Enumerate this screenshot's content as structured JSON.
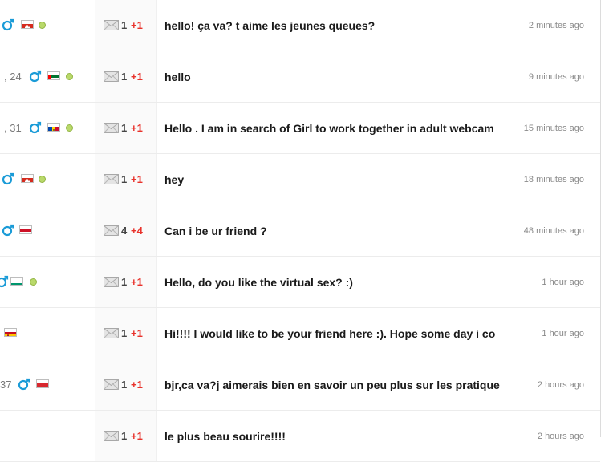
{
  "messages": [
    {
      "age": "",
      "flag": "switzerland-flag",
      "online": true,
      "male": true,
      "count": "1",
      "plus": "+1",
      "text": "hello! ça va? t aime les jeunes queues?",
      "time": "2 minutes ago"
    },
    {
      "age": ", 24",
      "flag": "uae-flag",
      "online": true,
      "male": true,
      "count": "1",
      "plus": "+1",
      "text": "hello",
      "time": "9 minutes ago"
    },
    {
      "age": ", 31",
      "flag": "moldova-flag",
      "online": true,
      "male": true,
      "count": "1",
      "plus": "+1",
      "text": "Hello . I am in search of Girl to work together in adult webcam",
      "time": "15 minutes ago"
    },
    {
      "age": "",
      "flag": "switzerland-flag",
      "online": true,
      "male": true,
      "count": "1",
      "plus": "+1",
      "text": "hey",
      "time": "18 minutes ago"
    },
    {
      "age": "",
      "flag": "yemen-flag",
      "online": false,
      "male": true,
      "count": "4",
      "plus": "+4",
      "text": "Can i be ur friend ?",
      "time": "48 minutes ago"
    },
    {
      "age": "",
      "flag": "bulgaria-flag",
      "online": true,
      "male": true,
      "count": "1",
      "plus": "+1",
      "text": "Hello, do you like the virtual sex? :)",
      "time": "1 hour ago"
    },
    {
      "age": "",
      "flag": "spain-flag",
      "online": false,
      "male": false,
      "count": "1",
      "plus": "+1",
      "text": "Hi!!!! I would like to be your friend here :). Hope some day i co",
      "time": "1 hour ago"
    },
    {
      "age": "37",
      "flag": "red-flag",
      "online": false,
      "male": true,
      "count": "1",
      "plus": "+1",
      "text": "bjr,ca va?j aimerais bien en savoir un peu plus sur les pratique",
      "time": "2 hours ago"
    },
    {
      "age": "",
      "flag": "",
      "online": false,
      "male": false,
      "count": "1",
      "plus": "+1",
      "text": "le plus beau sourire!!!!",
      "time": "2 hours ago"
    }
  ],
  "colors": {
    "male_icon": "#1a9bd7",
    "plus": "#e8322b",
    "online": "#b9d96a"
  }
}
